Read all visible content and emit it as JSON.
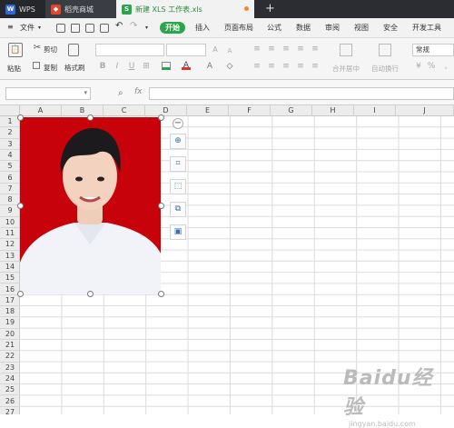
{
  "tabs": {
    "wps": "WPS",
    "store": "稻壳商城",
    "doc": "新建 XLS 工作表.xls",
    "plus": "+"
  },
  "menu": {
    "file": "文件",
    "start": "开始",
    "items": [
      "插入",
      "页面布局",
      "公式",
      "数据",
      "审阅",
      "视图",
      "安全",
      "开发工具"
    ]
  },
  "ribbon": {
    "paste": "粘贴",
    "cut": "剪切",
    "copy": "复制",
    "format_painter": "格式刷",
    "merge_center": "合并居中",
    "auto_wrap": "自动换行",
    "number_format": "常规"
  },
  "formula": {
    "fx": "fx",
    "value": ""
  },
  "columns": [
    "A",
    "B",
    "C",
    "D",
    "E",
    "F",
    "G",
    "H",
    "I",
    "J"
  ],
  "rows": [
    "1",
    "2",
    "3",
    "4",
    "5",
    "6",
    "7",
    "8",
    "9",
    "10",
    "11",
    "12",
    "13",
    "14",
    "15",
    "16",
    "17",
    "18",
    "19",
    "20",
    "21",
    "22",
    "23",
    "24",
    "25",
    "26",
    "27"
  ],
  "picture_tools": [
    "zoom-in-icon",
    "crop-icon",
    "select-area-icon",
    "copy-image-icon",
    "image-settings-icon"
  ],
  "watermark": {
    "main": "Baidu经验",
    "sub": "jingyan.baidu.com"
  },
  "colors": {
    "accent": "#2aa54a",
    "photo_bg": "#c7020a"
  }
}
